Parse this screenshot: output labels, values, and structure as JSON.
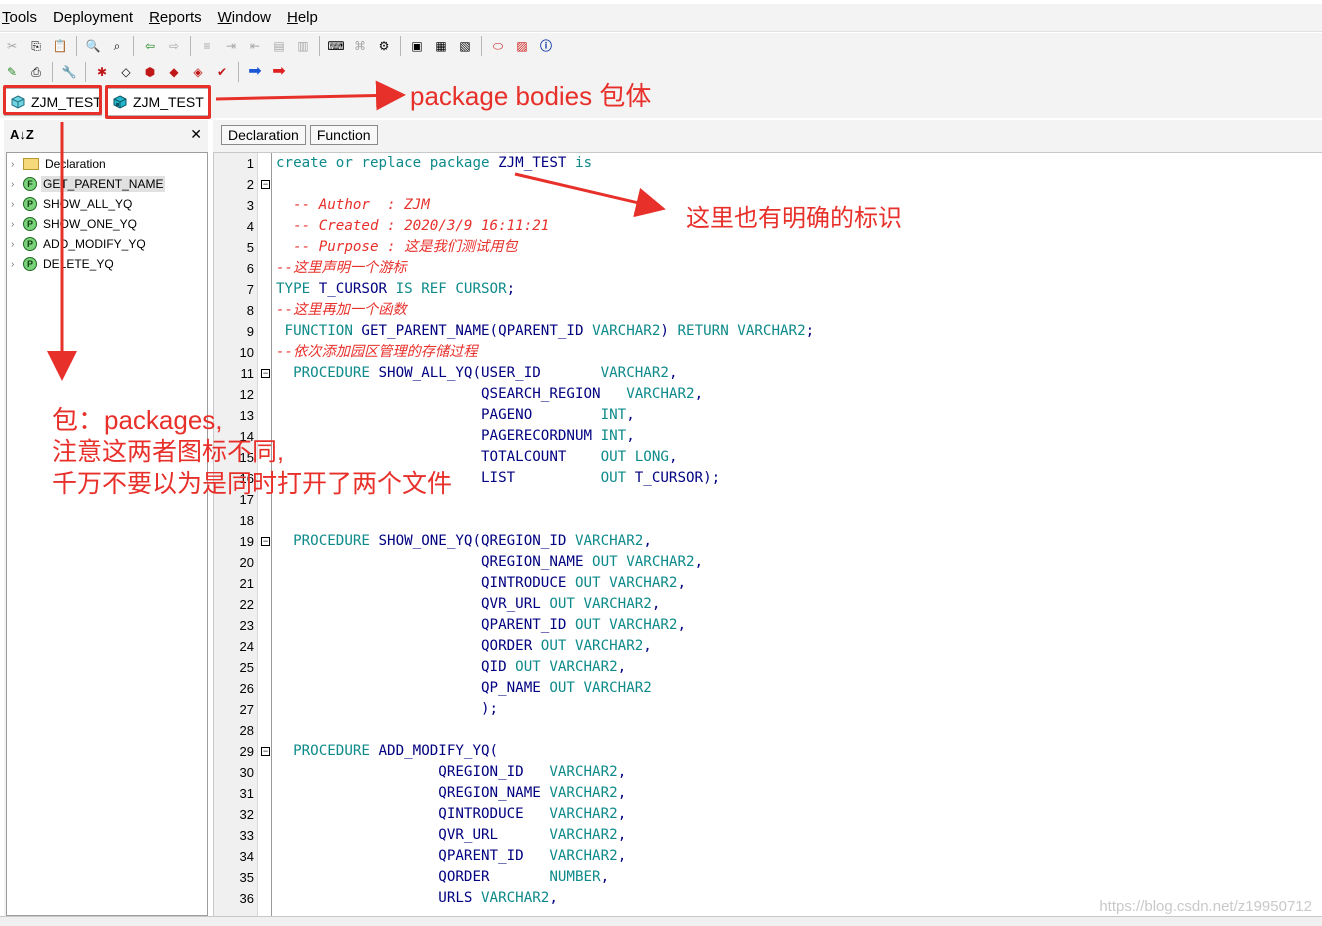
{
  "menu": [
    {
      "label": "Tools",
      "acc": "T",
      "rest": "ools"
    },
    {
      "label": "Deployment",
      "acc": "",
      "rest": "Deployment"
    },
    {
      "label": "Reports",
      "acc": "R",
      "rest": "eports"
    },
    {
      "label": "Window",
      "acc": "W",
      "rest": "indow"
    },
    {
      "label": "Help",
      "acc": "H",
      "rest": "elp"
    }
  ],
  "tabs": [
    {
      "label": "ZJM_TEST",
      "icon": "package-spec-icon"
    },
    {
      "label": "ZJM_TEST",
      "icon": "package-body-icon"
    }
  ],
  "left_panel": {
    "sort_icon": "A↓Z",
    "close": "✕",
    "tree": [
      {
        "label": "Declaration",
        "kind": "folder",
        "badge": ""
      },
      {
        "label": "GET_PARENT_NAME",
        "kind": "function",
        "badge": "F",
        "selected": true
      },
      {
        "label": "SHOW_ALL_YQ",
        "kind": "procedure",
        "badge": "P"
      },
      {
        "label": "SHOW_ONE_YQ",
        "kind": "procedure",
        "badge": "P"
      },
      {
        "label": "ADD_MODIFY_YQ",
        "kind": "procedure",
        "badge": "P"
      },
      {
        "label": "DELETE_YQ",
        "kind": "procedure",
        "badge": "P"
      }
    ]
  },
  "subtabs": [
    "Declaration",
    "Function"
  ],
  "code_lines": [
    {
      "n": "1",
      "fold": "",
      "t": "<span class='kw'>create or replace package</span> ZJM_TEST <span class='kw'>is</span>"
    },
    {
      "n": "2",
      "fold": "−",
      "t": ""
    },
    {
      "n": "3",
      "fold": "",
      "t": "<span class='cm'>  -- Author  : ZJM</span>"
    },
    {
      "n": "4",
      "fold": "",
      "t": "<span class='cm'>  -- Created : 2020/3/9 16:11:21</span>"
    },
    {
      "n": "5",
      "fold": "",
      "t": "<span class='cm'>  -- Purpose : 这是我们测试用包</span>"
    },
    {
      "n": "6",
      "fold": "",
      "t": "<span class='cm'>--这里声明一个游标</span>"
    },
    {
      "n": "7",
      "fold": "",
      "t": "<span class='kw'>TYPE</span> T_CURSOR <span class='kw'>IS REF CURSOR</span>;"
    },
    {
      "n": "8",
      "fold": "",
      "t": "<span class='cm'>--这里再加一个函数</span>"
    },
    {
      "n": "9",
      "fold": "",
      "t": " <span class='kw'>FUNCTION</span> GET_PARENT_NAME(QPARENT_ID <span class='kw'>VARCHAR2</span>) <span class='kw'>RETURN VARCHAR2</span>;"
    },
    {
      "n": "10",
      "fold": "",
      "t": "<span class='cm'>--依次添加园区管理的存储过程</span>"
    },
    {
      "n": "11",
      "fold": "−",
      "t": "  <span class='kw'>PROCEDURE</span> SHOW_ALL_YQ(USER_ID       <span class='kw'>VARCHAR2</span>,"
    },
    {
      "n": "12",
      "fold": "",
      "t": "                        QSEARCH_REGION   <span class='kw'>VARCHAR2</span>,"
    },
    {
      "n": "13",
      "fold": "",
      "t": "                        PAGENO        <span class='kw'>INT</span>,"
    },
    {
      "n": "14",
      "fold": "",
      "t": "                        PAGERECORDNUM <span class='kw'>INT</span>,"
    },
    {
      "n": "15",
      "fold": "",
      "t": "                        TOTALCOUNT    <span class='kw'>OUT LONG</span>,"
    },
    {
      "n": "16",
      "fold": "",
      "t": "                        LIST          <span class='kw'>OUT</span> T_CURSOR);"
    },
    {
      "n": "17",
      "fold": "",
      "t": ""
    },
    {
      "n": "18",
      "fold": "",
      "t": ""
    },
    {
      "n": "19",
      "fold": "−",
      "t": "  <span class='kw'>PROCEDURE</span> SHOW_ONE_YQ(QREGION_ID <span class='kw'>VARCHAR2</span>,"
    },
    {
      "n": "20",
      "fold": "",
      "t": "                        QREGION_NAME <span class='kw'>OUT VARCHAR2</span>,"
    },
    {
      "n": "21",
      "fold": "",
      "t": "                        QINTRODUCE <span class='kw'>OUT VARCHAR2</span>,"
    },
    {
      "n": "22",
      "fold": "",
      "t": "                        QVR_URL <span class='kw'>OUT VARCHAR2</span>,"
    },
    {
      "n": "23",
      "fold": "",
      "t": "                        QPARENT_ID <span class='kw'>OUT VARCHAR2</span>,"
    },
    {
      "n": "24",
      "fold": "",
      "t": "                        QORDER <span class='kw'>OUT VARCHAR2</span>,"
    },
    {
      "n": "25",
      "fold": "",
      "t": "                        QID <span class='kw'>OUT VARCHAR2</span>,"
    },
    {
      "n": "26",
      "fold": "",
      "t": "                        QP_NAME <span class='kw'>OUT VARCHAR2</span>"
    },
    {
      "n": "27",
      "fold": "",
      "t": "                        );"
    },
    {
      "n": "28",
      "fold": "",
      "t": ""
    },
    {
      "n": "29",
      "fold": "−",
      "t": "  <span class='kw'>PROCEDURE</span> ADD_MODIFY_YQ("
    },
    {
      "n": "30",
      "fold": "",
      "t": "                   QREGION_ID   <span class='kw'>VARCHAR2</span>,"
    },
    {
      "n": "31",
      "fold": "",
      "t": "                   QREGION_NAME <span class='kw'>VARCHAR2</span>,"
    },
    {
      "n": "32",
      "fold": "",
      "t": "                   QINTRODUCE   <span class='kw'>VARCHAR2</span>,"
    },
    {
      "n": "33",
      "fold": "",
      "t": "                   QVR_URL      <span class='kw'>VARCHAR2</span>,"
    },
    {
      "n": "34",
      "fold": "",
      "t": "                   QPARENT_ID   <span class='kw'>VARCHAR2</span>,"
    },
    {
      "n": "35",
      "fold": "",
      "t": "                   QORDER       <span class='kw'>NUMBER</span>,"
    },
    {
      "n": "36",
      "fold": "",
      "t": "                   URLS <span class='kw'>VARCHAR2</span>,"
    }
  ],
  "annotations": {
    "package_bodies": "package bodies 包体",
    "clear_mark": "这里也有明确的标识",
    "packages_note_1": "包：packages,",
    "packages_note_2": "注意这两者图标不同,",
    "packages_note_3": "千万不要以为是同时打开了两个文件",
    "color": "#e8302b"
  },
  "watermark": "https://blog.csdn.net/z19950712"
}
